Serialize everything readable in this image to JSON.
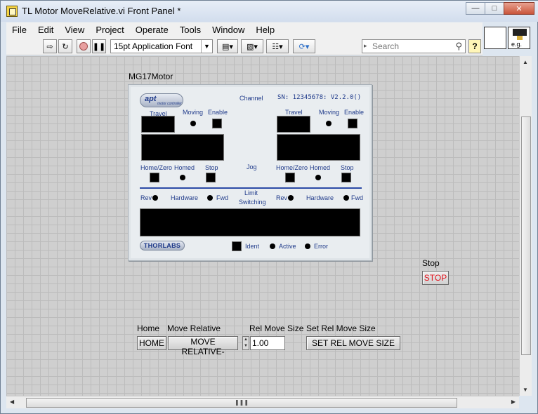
{
  "window": {
    "title": "TL Motor MoveRelative.vi Front Panel *"
  },
  "menu": [
    "File",
    "Edit",
    "View",
    "Project",
    "Operate",
    "Tools",
    "Window",
    "Help"
  ],
  "toolbar": {
    "font": "15pt Application Font",
    "search_placeholder": "Search",
    "help": "?"
  },
  "icon_pane": {
    "eg_label": "e.g."
  },
  "apt_control": {
    "label": "MG17Motor",
    "logo": "apt",
    "logo_sub": "motor controller",
    "channel": "Channel",
    "serial": "SN: 12345678: V2.2.0()",
    "travel": "Travel",
    "moving": "Moving",
    "enable": "Enable",
    "home_zero": "Home/Zero",
    "homed": "Homed",
    "stop": "Stop",
    "jog": "Jog",
    "rev": "Rev",
    "hardware": "Hardware",
    "fwd": "Fwd",
    "limit_switching_1": "Limit",
    "limit_switching_2": "Switching",
    "thorlabs": "THORLABS",
    "ident": "Ident",
    "active": "Active",
    "error": "Error"
  },
  "controls": {
    "stop_label": "Stop",
    "stop_button": "STOP",
    "home_label": "Home",
    "home_button": "HOME",
    "move_rel_label": "Move Relative",
    "move_rel_button": "MOVE RELATIVE-",
    "rel_move_size_label": "Rel Move Size",
    "rel_move_size_value": "1.00",
    "set_rel_label": "Set Rel Move Size",
    "set_rel_button": "SET REL MOVE SIZE"
  }
}
